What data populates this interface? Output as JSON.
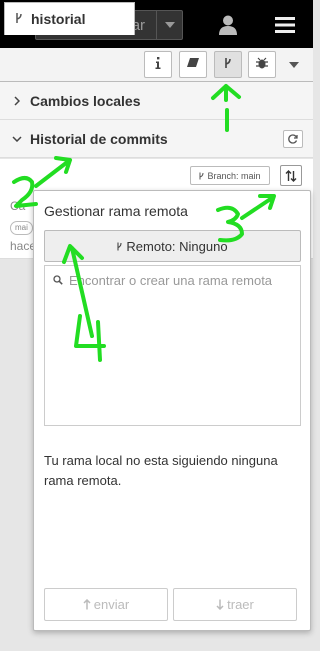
{
  "header": {
    "deploy_label": "Instanciar"
  },
  "tabs": {
    "active_label": "historial"
  },
  "sections": {
    "local_changes": "Cambios locales",
    "commit_history": "Historial de commits"
  },
  "branch": {
    "label": "Branch: main"
  },
  "commit_peek": {
    "line1": "Ca",
    "tag": "mai",
    "line3": "hace"
  },
  "popover": {
    "title": "Gestionar rama remota",
    "remote_label": "Remoto: Ninguno",
    "search_placeholder": "Encontrar o crear una rama remota",
    "status": "Tu rama local no esta siguiendo ninguna rama remota.",
    "push_label": "enviar",
    "pull_label": "traer"
  },
  "annotations": [
    "1",
    "2",
    "3",
    "4"
  ],
  "colors": {
    "header_bg": "#000000",
    "annotation": "#22dd22"
  }
}
